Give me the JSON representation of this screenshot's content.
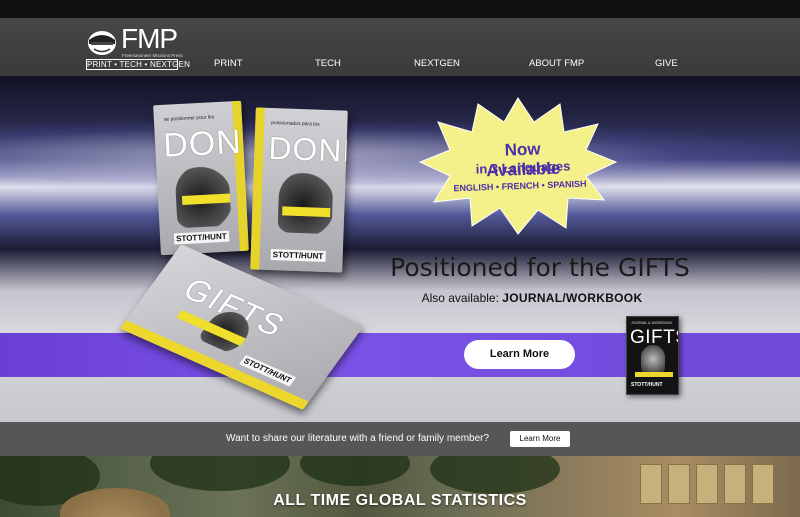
{
  "logo": {
    "title": "FMP",
    "subtitle": "Freemasoneer Missions Press",
    "tagline": "PRINT • TECH • NEXTGEN"
  },
  "nav": {
    "items": [
      {
        "label": "PRINT"
      },
      {
        "label": "TECH"
      },
      {
        "label": "NEXTGEN"
      },
      {
        "label": "ABOUT FMP"
      },
      {
        "label": "GIVE"
      }
    ]
  },
  "hero": {
    "books": {
      "dons_fr_small": "se positionner pour les",
      "dons_fr_title": "DONS",
      "dons_es_small": "posicionados para los",
      "dons_es_title": "DONES",
      "gifts_title": "GIFTS",
      "author": "STOTT/HUNT"
    },
    "burst": {
      "line1": "Now Available",
      "line2": "in 3 Languages",
      "line3": "ENGLISH • FRENCH • SPANISH"
    },
    "heading": "Positioned for the GIFTS",
    "subtext_prefix": "Also available: ",
    "subtext_bold": "JOURNAL/WORKBOOK",
    "cta_label": "Learn More",
    "workbook": {
      "top": "JOURNAL & WORKBOOK",
      "title": "GIFTS",
      "author": "STOTT/HUNT"
    },
    "colors": {
      "band": "#7b53e8",
      "burst": "#f5f18a",
      "burst_text": "#4b2fa8",
      "spine": "#e7d42a"
    }
  },
  "share": {
    "text": "Want to share our literature with a friend or family member?",
    "button_label": "Learn More"
  },
  "stats": {
    "title": "ALL TIME GLOBAL STATISTICS"
  }
}
